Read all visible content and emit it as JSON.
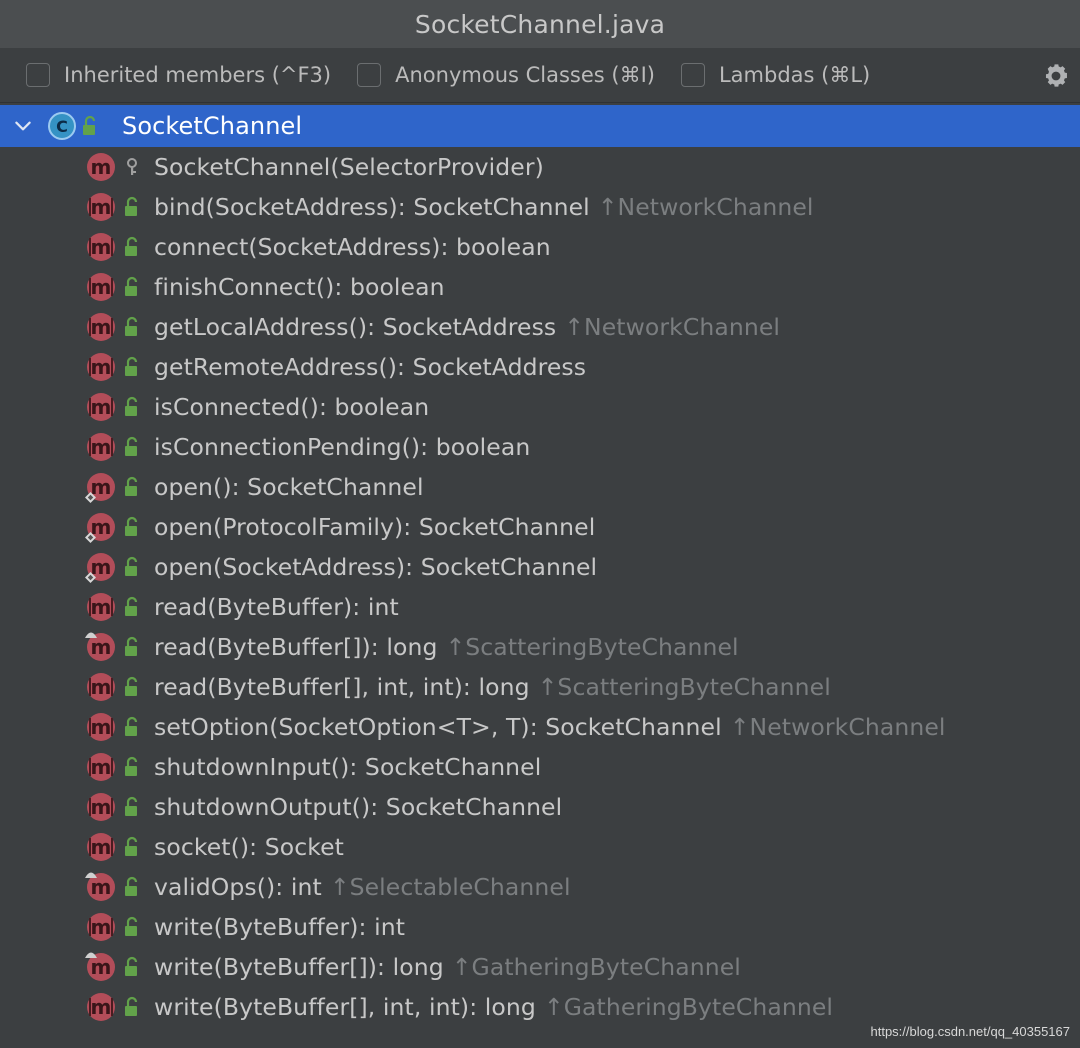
{
  "window": {
    "title": "SocketChannel.java"
  },
  "toolbar": {
    "options": [
      {
        "label": "Inherited members (^F3)",
        "checked": false
      },
      {
        "label": "Anonymous Classes (⌘I)",
        "checked": false
      },
      {
        "label": "Lambdas (⌘L)",
        "checked": false
      }
    ],
    "settings_icon": "gear-icon"
  },
  "tree": {
    "root": {
      "name": "SocketChannel",
      "icon": "class-icon",
      "visibility": "public"
    },
    "members": [
      {
        "text": "SocketChannel(SelectorProvider)",
        "inherited": "",
        "visibility": "protected"
      },
      {
        "text": "bind(SocketAddress): SocketChannel",
        "inherited": "↑NetworkChannel",
        "visibility": "public",
        "abstract": true
      },
      {
        "text": "connect(SocketAddress): boolean",
        "inherited": "",
        "visibility": "public",
        "abstract": true
      },
      {
        "text": "finishConnect(): boolean",
        "inherited": "",
        "visibility": "public",
        "abstract": true
      },
      {
        "text": "getLocalAddress(): SocketAddress",
        "inherited": "↑NetworkChannel",
        "visibility": "public",
        "abstract": true
      },
      {
        "text": "getRemoteAddress(): SocketAddress",
        "inherited": "",
        "visibility": "public",
        "abstract": true
      },
      {
        "text": "isConnected(): boolean",
        "inherited": "",
        "visibility": "public",
        "abstract": true
      },
      {
        "text": "isConnectionPending(): boolean",
        "inherited": "",
        "visibility": "public",
        "abstract": true
      },
      {
        "text": "open(): SocketChannel",
        "inherited": "",
        "visibility": "public",
        "static": true
      },
      {
        "text": "open(ProtocolFamily): SocketChannel",
        "inherited": "",
        "visibility": "public",
        "static": true
      },
      {
        "text": "open(SocketAddress): SocketChannel",
        "inherited": "",
        "visibility": "public",
        "static": true
      },
      {
        "text": "read(ByteBuffer): int",
        "inherited": "",
        "visibility": "public",
        "abstract": true
      },
      {
        "text": "read(ByteBuffer[]): long",
        "inherited": "↑ScatteringByteChannel",
        "visibility": "public",
        "override": true
      },
      {
        "text": "read(ByteBuffer[], int, int): long",
        "inherited": "↑ScatteringByteChannel",
        "visibility": "public",
        "abstract": true
      },
      {
        "text": "setOption(SocketOption<T>, T): SocketChannel",
        "inherited": "↑NetworkChannel",
        "visibility": "public",
        "abstract": true
      },
      {
        "text": "shutdownInput(): SocketChannel",
        "inherited": "",
        "visibility": "public",
        "abstract": true
      },
      {
        "text": "shutdownOutput(): SocketChannel",
        "inherited": "",
        "visibility": "public",
        "abstract": true
      },
      {
        "text": "socket(): Socket",
        "inherited": "",
        "visibility": "public",
        "abstract": true
      },
      {
        "text": "validOps(): int",
        "inherited": "↑SelectableChannel",
        "visibility": "public",
        "override": true
      },
      {
        "text": "write(ByteBuffer): int",
        "inherited": "",
        "visibility": "public",
        "abstract": true
      },
      {
        "text": "write(ByteBuffer[]): long",
        "inherited": "↑GatheringByteChannel",
        "visibility": "public",
        "override": true
      },
      {
        "text": "write(ByteBuffer[], int, int): long",
        "inherited": "↑GatheringByteChannel",
        "visibility": "public",
        "abstract": true
      }
    ]
  },
  "watermark": "https://blog.csdn.net/qq_40355167",
  "colors": {
    "selection": "#2f65ca",
    "method_icon": "#b34d59",
    "class_icon": "#3592c4",
    "lock_green": "#62a24a",
    "inherited_text": "#7b7e80",
    "background": "#3c3f41"
  }
}
